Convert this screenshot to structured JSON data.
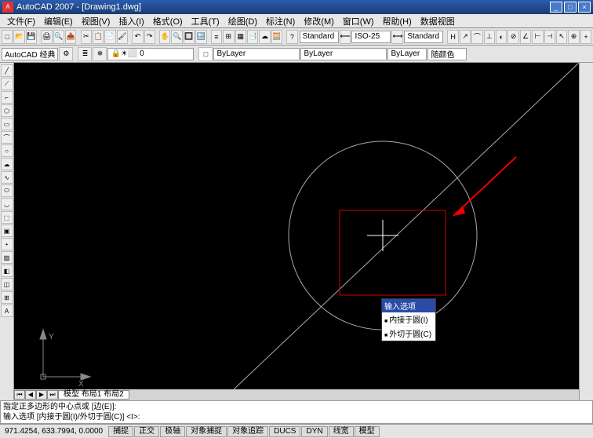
{
  "app": {
    "icon_text": "A",
    "title": "AutoCAD 2007 - [Drawing1.dwg]"
  },
  "menu": {
    "items": [
      "文件(F)",
      "编辑(E)",
      "视图(V)",
      "插入(I)",
      "格式(O)",
      "工具(T)",
      "绘图(D)",
      "标注(N)",
      "修改(M)",
      "窗口(W)",
      "帮助(H)",
      "数据视图"
    ]
  },
  "toolbar1": {
    "workspace": "AutoCAD 经典"
  },
  "toolbar2": {
    "style1": "Standard",
    "scale": "ISO-25",
    "style2": "Standard"
  },
  "toolbar3": {
    "layer": "ByLayer",
    "linetype": "ByLayer",
    "color_label": "随颜色"
  },
  "context_menu": {
    "header": "输入选项",
    "opt1": "内接于圆(I)",
    "opt2": "外切于圆(C)"
  },
  "tabs": {
    "labels": "模型 布局1 布局2"
  },
  "cmd": {
    "line1": "指定正多边形的中心点或 [边(E)]:",
    "line2": "输入选项 [内接于圆(I)/外切于圆(C)] <I>:"
  },
  "status": {
    "coords": "971.4254, 633.7994, 0.0000",
    "buttons": [
      "捕捉",
      "正交",
      "极轴",
      "对象捕捉",
      "对象追踪",
      "DUCS",
      "DYN",
      "线宽",
      "模型"
    ]
  },
  "axes": {
    "x": "X",
    "y": "Y"
  }
}
